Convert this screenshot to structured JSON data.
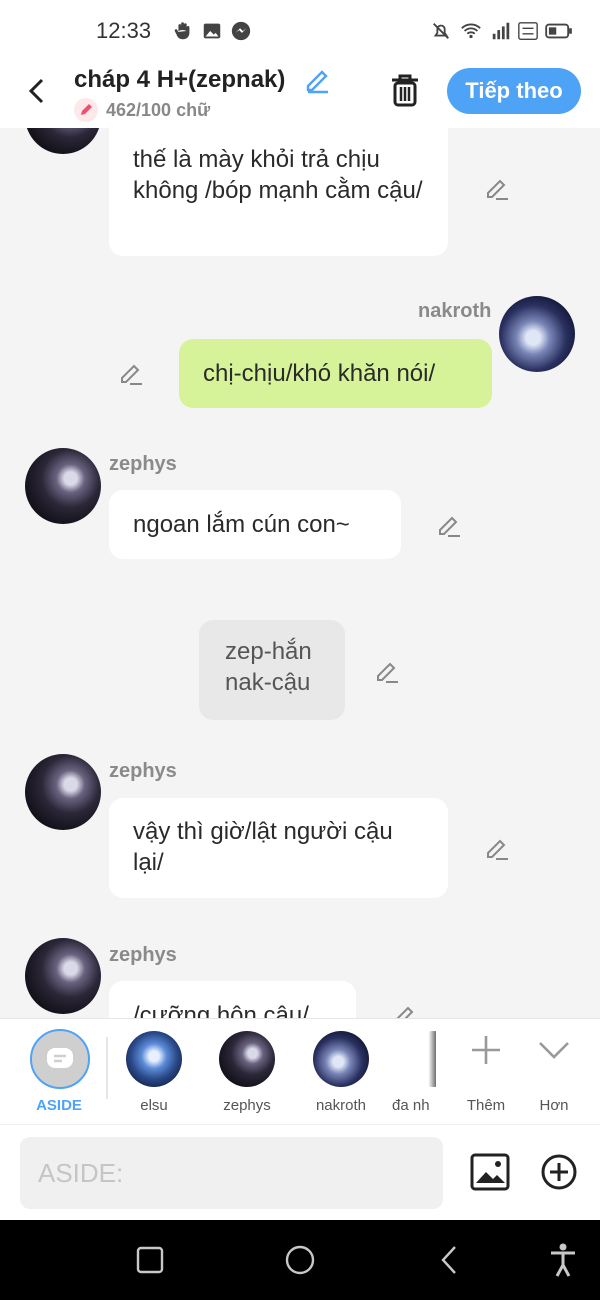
{
  "status": {
    "time": "12:33"
  },
  "header": {
    "title": "cháp 4 H+(zepnak)",
    "word_count": "462/100 chữ",
    "next_label": "Tiếp theo"
  },
  "messages": [
    {
      "speaker": "",
      "text": "thế là mày khỏi trả chịu không /bóp mạnh cằm cậu/"
    },
    {
      "speaker": "nakroth",
      "text": "chị-chịu/khó khăn nói/"
    },
    {
      "speaker": "zephys",
      "text": "ngoan lắm cún con~"
    },
    {
      "speaker": "",
      "text": "zep-hắn nak-cậu"
    },
    {
      "speaker": "zephys",
      "text": "vậy thì giờ/lật người cậu lại/"
    },
    {
      "speaker": "zephys",
      "text": "/cưỡng hôn cậu/"
    }
  ],
  "tray": {
    "aside_label": "ASIDE",
    "characters": [
      "elsu",
      "zephys",
      "nakroth",
      "đa nh"
    ],
    "more_label": "Thêm",
    "collapse_label": "Hơn"
  },
  "composer": {
    "placeholder": "ASIDE:"
  },
  "colors": {
    "accent": "#4fa3f7",
    "my_bubble": "#d6f39a"
  }
}
